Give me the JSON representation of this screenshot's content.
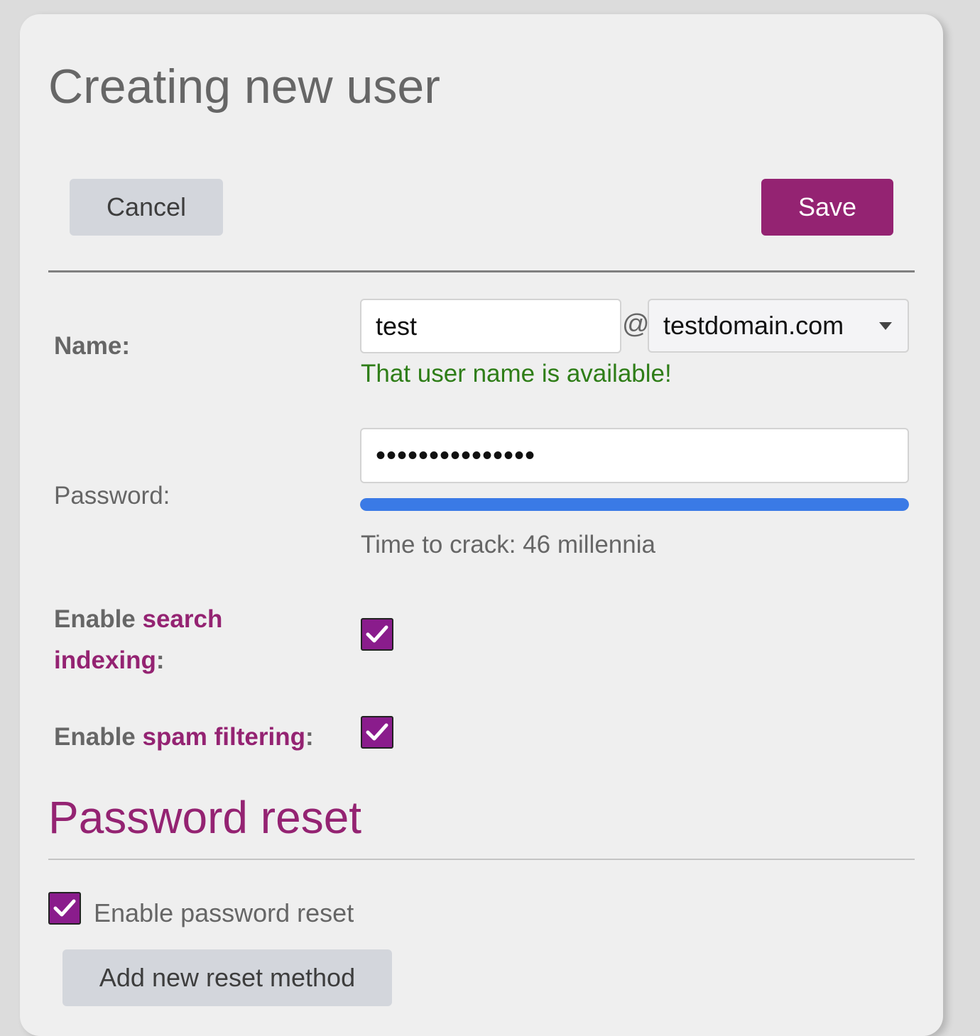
{
  "page": {
    "title": "Creating new user"
  },
  "toolbar": {
    "cancel_label": "Cancel",
    "save_label": "Save"
  },
  "form": {
    "name": {
      "label": "Name:",
      "username_value": "test",
      "at_sign": "@",
      "domain_value": "testdomain.com",
      "availability_message": "That user name is available!"
    },
    "password": {
      "label": "Password:",
      "masked_value": "•••••••••••••••",
      "strength_percent": 100,
      "crack_time_text": "Time to crack: 46 millennia"
    },
    "search_indexing": {
      "label_prefix": "Enable ",
      "label_accent_1": "search",
      "label_accent_2": "indexing",
      "label_suffix": ":",
      "checked": true
    },
    "spam_filtering": {
      "label_prefix": "Enable ",
      "label_accent": "spam filtering",
      "label_suffix": ":",
      "checked": true
    }
  },
  "password_reset": {
    "title": "Password reset",
    "enable_label": "Enable password reset",
    "enabled": true,
    "add_method_label": "Add new reset method"
  },
  "colors": {
    "accent": "#942372",
    "checkbox_fill": "#8a1c8c",
    "success": "#2e7d17",
    "strength_bar": "#3a7ae6"
  },
  "icons": {
    "checkbox": "checkmark-icon",
    "dropdown": "caret-down-icon"
  }
}
